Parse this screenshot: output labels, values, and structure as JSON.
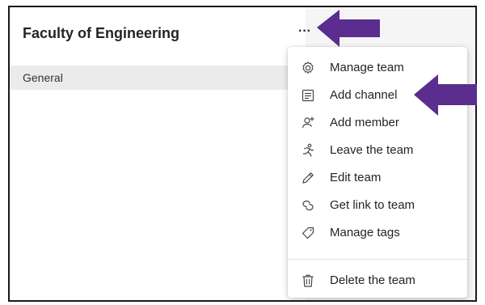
{
  "team": {
    "name": "Faculty of Engineering",
    "more_label": "···"
  },
  "channels": [
    {
      "label": "General"
    }
  ],
  "menu": {
    "items": [
      {
        "label": "Manage team",
        "icon": "gear-icon"
      },
      {
        "label": "Add channel",
        "icon": "channel-icon"
      },
      {
        "label": "Add member",
        "icon": "add-member-icon"
      },
      {
        "label": "Leave the team",
        "icon": "leave-icon"
      },
      {
        "label": "Edit team",
        "icon": "pencil-icon"
      },
      {
        "label": "Get link to team",
        "icon": "link-icon"
      },
      {
        "label": "Manage tags",
        "icon": "tag-icon"
      },
      {
        "label": "Delete the team",
        "icon": "trash-icon"
      }
    ]
  },
  "annotations": {
    "arrow_color": "#5b2d8e"
  }
}
